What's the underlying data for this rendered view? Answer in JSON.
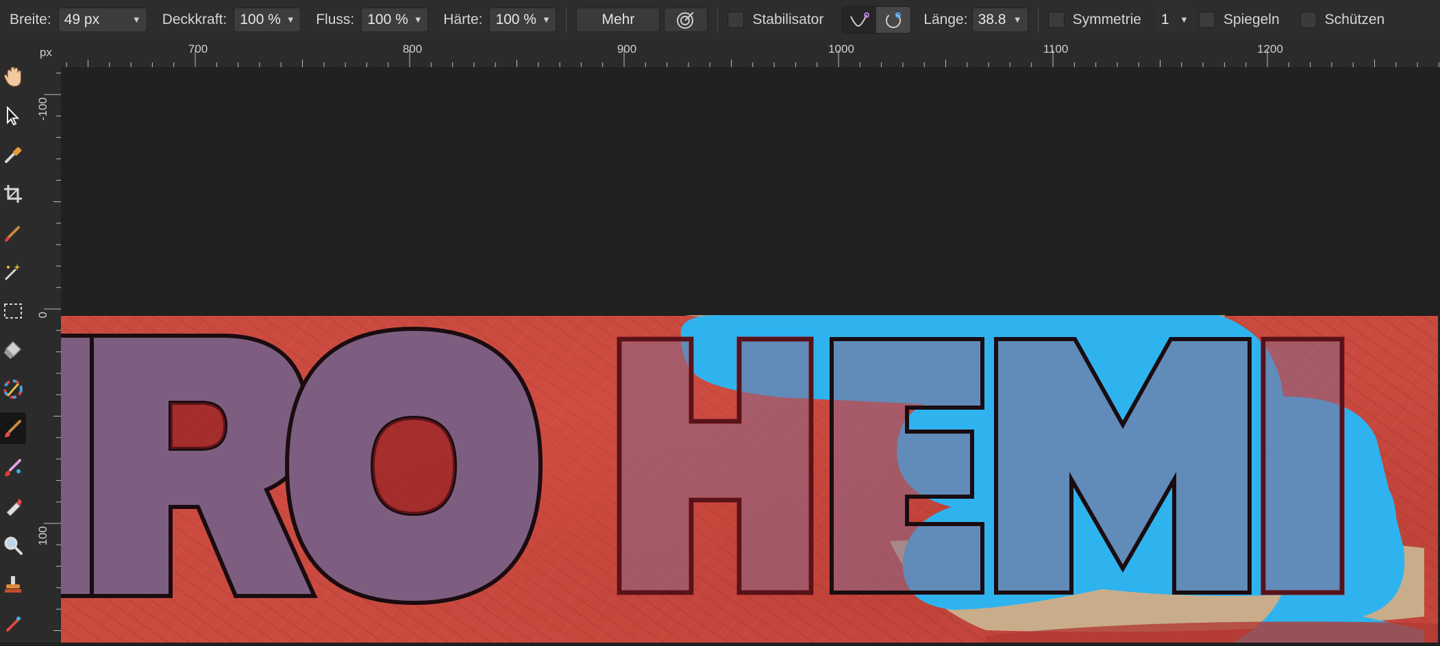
{
  "toolbar": {
    "width_label": "Breite:",
    "width_value": "49 px",
    "opacity_label": "Deckkraft:",
    "opacity_value": "100 %",
    "flow_label": "Fluss:",
    "flow_value": "100 %",
    "hardness_label": "Härte:",
    "hardness_value": "100 %",
    "more_label": "Mehr",
    "stabilizer_label": "Stabilisator",
    "length_label": "Länge:",
    "length_value": "38.8",
    "symmetry_label": "Symmetrie",
    "symmetry_count": "1",
    "mirror_label": "Spiegeln",
    "protect_label": "Schützen"
  },
  "ruler": {
    "unit": "px",
    "top_labels": [
      "700",
      "800",
      "900",
      "1000",
      "1100",
      "1200"
    ],
    "left_labels": [
      "-100",
      "0",
      "100"
    ]
  },
  "canvas": {
    "text_left": "TRO",
    "text_right": "HEMI"
  },
  "colors": {
    "background": "#c94a3f",
    "letter_fill": "#7d5e80",
    "mask_blue": "#2fb3ef",
    "outline": "#1a0c10"
  },
  "tools": [
    {
      "name": "hand-tool-icon"
    },
    {
      "name": "move-tool-icon"
    },
    {
      "name": "color-picker-tool-icon"
    },
    {
      "name": "crop-tool-icon"
    },
    {
      "name": "brush-tool-icon"
    },
    {
      "name": "selection-brush-tool-icon"
    },
    {
      "name": "marquee-tool-icon"
    },
    {
      "name": "fill-tool-icon"
    },
    {
      "name": "gradient-tool-icon"
    },
    {
      "name": "paint-brush-tool-icon"
    },
    {
      "name": "pixel-tool-icon"
    },
    {
      "name": "dodge-tool-icon"
    },
    {
      "name": "zoom-tool-icon"
    },
    {
      "name": "clone-tool-icon"
    },
    {
      "name": "retouch-tool-icon"
    }
  ]
}
